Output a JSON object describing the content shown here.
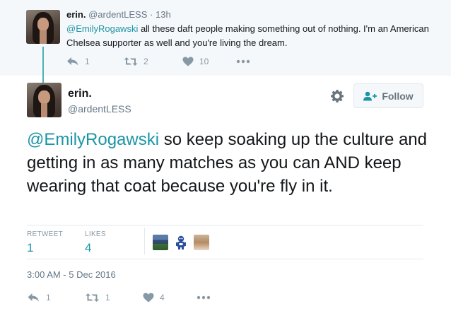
{
  "parent_tweet": {
    "name": "erin.",
    "handle": "@ardentLESS",
    "time": "13h",
    "mention": "@EmilyRogawski",
    "text": " all these daft people making something out of nothing. I'm an American Chelsea supporter as well and you're living the dream.",
    "actions": {
      "reply_count": "1",
      "retweet_count": "2",
      "like_count": "10"
    }
  },
  "main_tweet": {
    "name": "erin.",
    "handle": "@ardentLESS",
    "follow_label": "Follow",
    "mention": "@EmilyRogawski",
    "text": " so keep soaking up the culture and getting in as many matches as you can AND keep wearing that coat because you're fly in it.",
    "stats": {
      "retweet_label": "RETWEET",
      "retweet_count": "1",
      "likes_label": "LIKES",
      "likes_count": "4"
    },
    "timestamp": "3:00 AM - 5 Dec 2016",
    "actions": {
      "reply_count": "1",
      "retweet_count": "1",
      "like_count": "4"
    }
  },
  "colors": {
    "accent": "#1b95a6",
    "icon_gray": "#8899a6",
    "thread_line": "#4bb3b3"
  },
  "icons": [
    "reply-icon",
    "retweet-icon",
    "heart-icon",
    "more-icon",
    "gear-icon",
    "follow-person-icon"
  ]
}
